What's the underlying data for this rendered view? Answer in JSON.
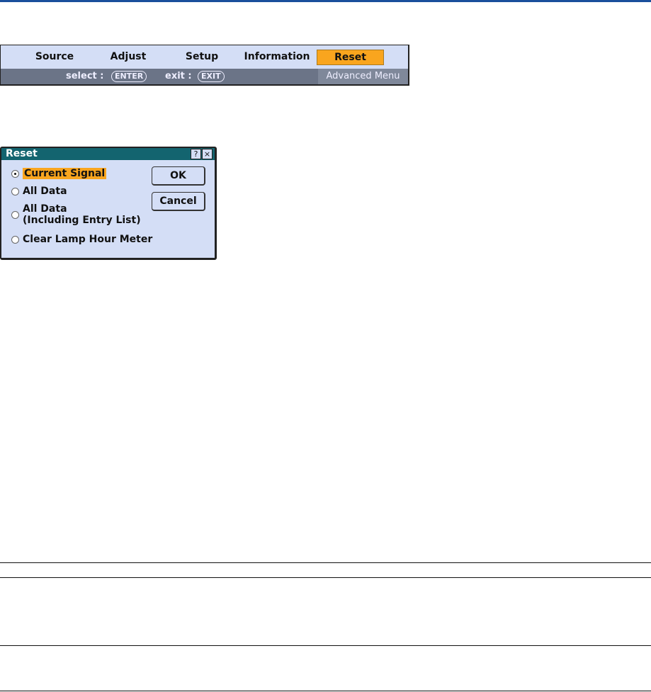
{
  "menu": {
    "tabs": [
      "Source",
      "Adjust",
      "Setup",
      "Information",
      "Reset"
    ],
    "selected": "Reset",
    "hint": {
      "select_label": "select :",
      "select_key": "ENTER",
      "exit_label": "exit :",
      "exit_key": "EXIT",
      "mode": "Advanced Menu"
    }
  },
  "dialog": {
    "title": "Reset",
    "help_icon": "?",
    "close_icon": "×",
    "options": [
      "Current Signal",
      "All Data",
      "All Data",
      "(Including Entry List)",
      "Clear Lamp Hour Meter"
    ],
    "ok": "OK",
    "cancel": "Cancel"
  },
  "colors": {
    "accent": "#f9a51e",
    "titlebar": "#13646f",
    "menu_bg": "#d4def6",
    "hint_bg": "#6b7487"
  }
}
